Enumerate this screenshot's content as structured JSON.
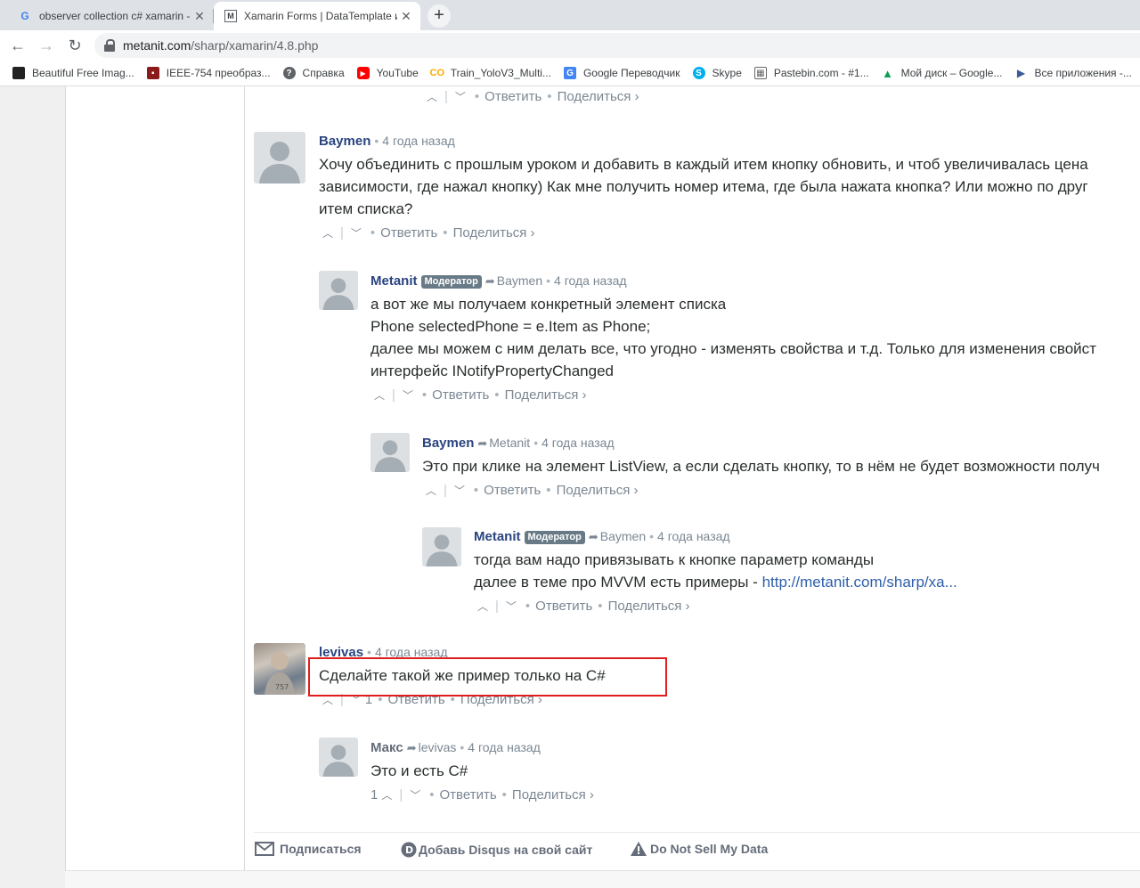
{
  "browser": {
    "tabs": [
      {
        "title": "observer collection c# xamarin - I",
        "favicon": "G"
      },
      {
        "title": "Xamarin Forms | DataTemplate и",
        "favicon": "M"
      }
    ],
    "url_host": "metanit.com",
    "url_path": "/sharp/xamarin/4.8.php",
    "bookmarks": [
      {
        "label": "Beautiful Free Imag...",
        "icon": "unsplash-icon",
        "color": "#222222"
      },
      {
        "label": "IEEE-754 преобраз...",
        "icon": "ieee-icon",
        "color": "#8b1a1a"
      },
      {
        "label": "Справка",
        "icon": "help-icon",
        "color": "#5f6368"
      },
      {
        "label": "YouTube",
        "icon": "youtube-icon",
        "color": "#ff0000"
      },
      {
        "label": "Train_YoloV3_Multi...",
        "icon": "colab-icon",
        "color": "#f9ab00"
      },
      {
        "label": "Google Переводчик",
        "icon": "translate-icon",
        "color": "#4285f4"
      },
      {
        "label": "Skype",
        "icon": "skype-icon",
        "color": "#00aff0"
      },
      {
        "label": "Pastebin.com - #1...",
        "icon": "pastebin-icon",
        "color": "#666666"
      },
      {
        "label": "Мой диск – Google...",
        "icon": "drive-icon",
        "color": "#0f9d58"
      },
      {
        "label": "Все приложения -...",
        "icon": "apps-icon",
        "color": "#3c5a99"
      }
    ]
  },
  "common": {
    "reply": "Ответить",
    "share": "Поделиться ›",
    "moderator": "Модератор"
  },
  "comments": [
    {
      "id": "top",
      "actions_only": true
    },
    {
      "id": "c1",
      "author": "Baymen",
      "time": "4 года назад",
      "lines": [
        "Хочу объединить с прошлым уроком и добавить в каждый итем кнопку обновить, и чтоб увеличивалась цена",
        "зависимости, где нажал кнопку) Как мне получить номер итема, где была нажата кнопка? Или можно по друг",
        "итем списка?"
      ]
    },
    {
      "id": "c2",
      "author": "Metanit",
      "moderator": true,
      "reply_to": "Baymen",
      "time": "4 года назад",
      "lines": [
        "а вот же мы получаем конкретный элемент списка",
        "Phone selectedPhone = e.Item as Phone;",
        "далее мы можем с ним делать все, что угодно - изменять свойства и т.д. Только для изменения свойст",
        "интерфейс INotifyPropertyChanged"
      ]
    },
    {
      "id": "c3",
      "author": "Baymen",
      "reply_to": "Metanit",
      "time": "4 года назад",
      "lines": [
        "Это при клике на элемент ListView, а если сделать кнопку, то в нём не будет возможности получ"
      ]
    },
    {
      "id": "c4",
      "author": "Metanit",
      "moderator": true,
      "reply_to": "Baymen",
      "time": "4 года назад",
      "lines": [
        "тогда вам надо привязывать к кнопке параметр команды"
      ],
      "line2_prefix": "далее в теме про MVVM есть примеры - ",
      "line2_link": "http://metanit.com/sharp/xa..."
    },
    {
      "id": "c5",
      "author": "levivas",
      "time": "4 года назад",
      "votes": "1",
      "lines": [
        "Сделайте такой же пример только на C#"
      ]
    },
    {
      "id": "c6",
      "author": "Макс",
      "reply_to": "levivas",
      "time": "4 года назад",
      "votes": "1",
      "lines": [
        "Это и есть C#"
      ]
    }
  ],
  "footer": {
    "subscribe": "Подписаться",
    "add_disqus": "Добавь Disqus на свой сайт",
    "do_not_sell": "Do Not Sell My Data"
  }
}
